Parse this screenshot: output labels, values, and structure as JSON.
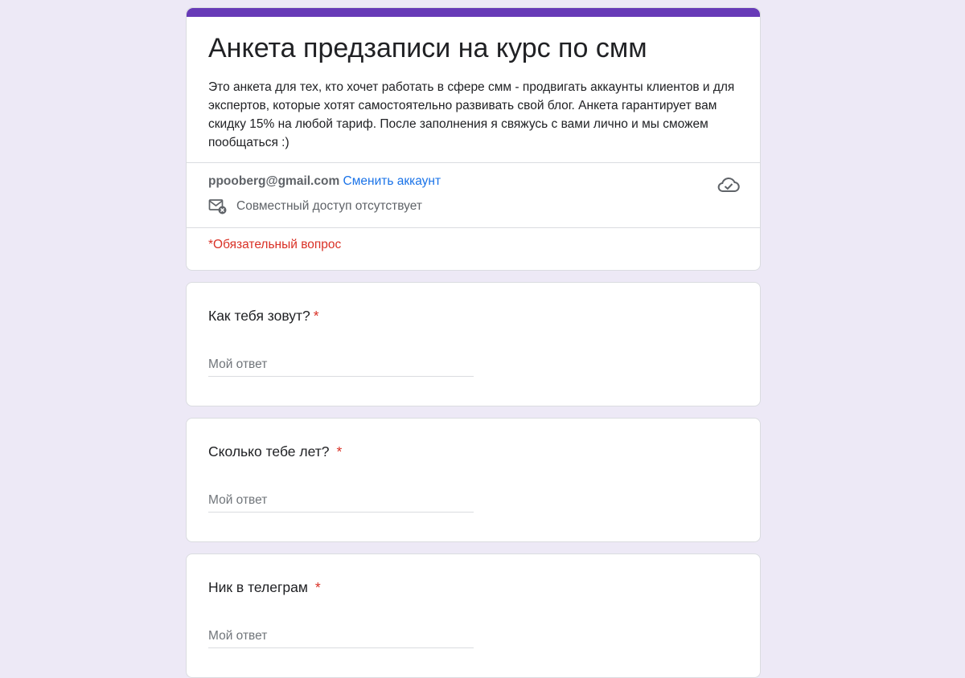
{
  "form": {
    "title": "Анкета предзаписи на курс по смм",
    "description": "Это анкета для тех, кто хочет работать в сфере смм - продвигать аккаунты клиентов и для экспертов, которые хотят самостоятельно развивать свой блог. Анкета гарантирует вам скидку 15% на любой тариф. После заполнения я свяжусь с вами лично и мы сможем пообщаться :)",
    "account_email": "ppooberg@gmail.com",
    "switch_account_label": "Сменить аккаунт",
    "sharing_status": "Совместный доступ отсутствует",
    "required_note": "*Обязательный вопрос"
  },
  "questions": [
    {
      "title": "Как тебя зовут?",
      "required_mark": "*",
      "placeholder": "Мой ответ"
    },
    {
      "title": "Сколько тебе лет?",
      "required_mark": "*",
      "placeholder": "Мой ответ"
    },
    {
      "title": "Ник в телеграм",
      "required_mark": "*",
      "placeholder": "Мой ответ"
    }
  ],
  "colors": {
    "accent": "#673ab7",
    "background": "#ede9f6",
    "link": "#1a73e8",
    "required": "#d93025"
  },
  "icons": {
    "sharing": "mail-off-icon",
    "saved": "cloud-done-icon"
  }
}
